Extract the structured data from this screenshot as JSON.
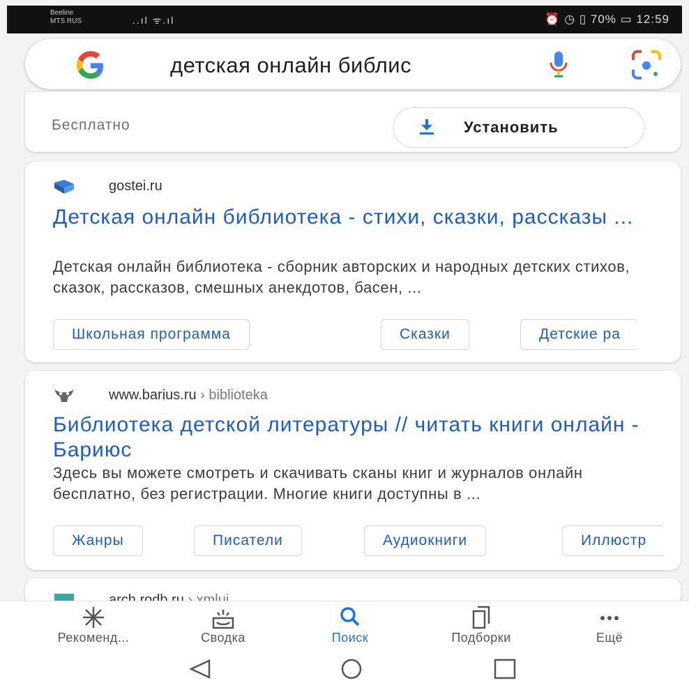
{
  "status_bar": {
    "carrier_line1": "Beeline",
    "carrier_line2": "MTS RUS",
    "signal": "..ıl ᯤ.ıl",
    "battery": "70%",
    "time": "12:59"
  },
  "search": {
    "query": "детская онлайн библиc"
  },
  "app_card": {
    "price_label": "Бесплатно",
    "install_label": "Установить"
  },
  "results": [
    {
      "site": "gostei.ru",
      "path": "",
      "title": "Детская онлайн библиотека - стихи, сказки, рассказы ...",
      "snippet": "Детская онлайн библиотека - сборник авторских и народных детских стихов, сказок, рассказов, смешных анекдотов, басен, ...",
      "chips": [
        "Школьная программа",
        "Сказки",
        "Детские ра"
      ]
    },
    {
      "site": "www.barius.ru",
      "path": " › biblioteka",
      "title": "Библиотека детской литературы // читать книги онлайн - Бариюс",
      "snippet": "Здесь вы можете смотреть и скачивать сканы книг и журналов онлайн бесплатно, без регистрации. Многие книги доступны в ...",
      "chips": [
        "Жанры",
        "Писатели",
        "Аудиокниги",
        "Иллюстр"
      ]
    },
    {
      "site": "arch.rodb.ru",
      "path": " › xmlui"
    }
  ],
  "bottom_nav": [
    {
      "label": "Рекоменд...",
      "icon": "asterisk-icon"
    },
    {
      "label": "Сводка",
      "icon": "summary-icon"
    },
    {
      "label": "Поиск",
      "icon": "search-icon"
    },
    {
      "label": "Подборки",
      "icon": "collections-icon"
    },
    {
      "label": "Ещё",
      "icon": "more-icon"
    }
  ],
  "colors": {
    "link_blue": "#1a5ccc",
    "active_blue": "#1a73e8"
  }
}
